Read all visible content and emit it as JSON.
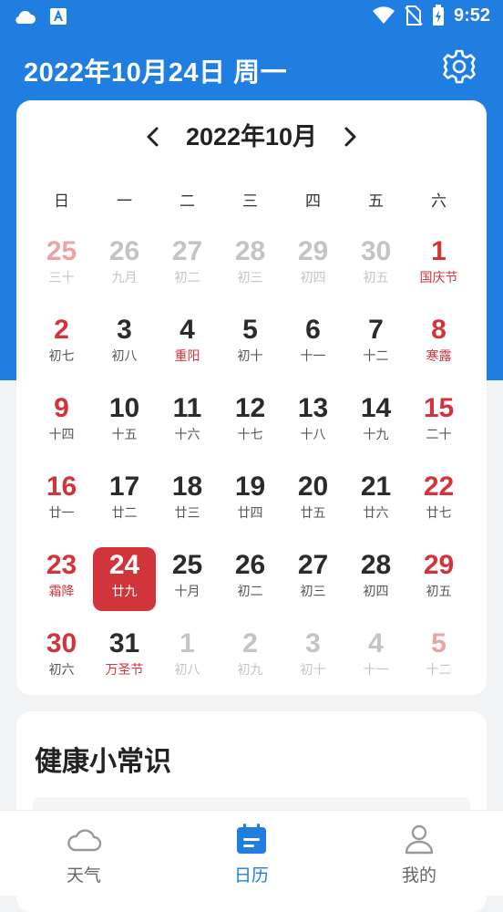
{
  "status_bar": {
    "time": "9:52"
  },
  "header": {
    "title": "2022年10月24日 周一"
  },
  "calendar": {
    "month_title": "2022年10月",
    "weekdays": [
      "日",
      "一",
      "二",
      "三",
      "四",
      "五",
      "六"
    ],
    "days": [
      {
        "num": "25",
        "sub": "三十",
        "type": "otherwk"
      },
      {
        "num": "26",
        "sub": "九月",
        "type": "other"
      },
      {
        "num": "27",
        "sub": "初二",
        "type": "other"
      },
      {
        "num": "28",
        "sub": "初三",
        "type": "other"
      },
      {
        "num": "29",
        "sub": "初四",
        "type": "other"
      },
      {
        "num": "30",
        "sub": "初五",
        "type": "other"
      },
      {
        "num": "1",
        "sub": "国庆节",
        "type": "wk fest"
      },
      {
        "num": "2",
        "sub": "初七",
        "type": "wk"
      },
      {
        "num": "3",
        "sub": "初八",
        "type": "dark"
      },
      {
        "num": "4",
        "sub": "重阳",
        "type": "dark fest"
      },
      {
        "num": "5",
        "sub": "初十",
        "type": "dark"
      },
      {
        "num": "6",
        "sub": "十一",
        "type": "dark"
      },
      {
        "num": "7",
        "sub": "十二",
        "type": "dark"
      },
      {
        "num": "8",
        "sub": "寒露",
        "type": "wk fest"
      },
      {
        "num": "9",
        "sub": "十四",
        "type": "wk"
      },
      {
        "num": "10",
        "sub": "十五",
        "type": "dark"
      },
      {
        "num": "11",
        "sub": "十六",
        "type": "dark"
      },
      {
        "num": "12",
        "sub": "十七",
        "type": "dark"
      },
      {
        "num": "13",
        "sub": "十八",
        "type": "dark"
      },
      {
        "num": "14",
        "sub": "十九",
        "type": "dark"
      },
      {
        "num": "15",
        "sub": "二十",
        "type": "wk"
      },
      {
        "num": "16",
        "sub": "廿一",
        "type": "wk"
      },
      {
        "num": "17",
        "sub": "廿二",
        "type": "dark"
      },
      {
        "num": "18",
        "sub": "廿三",
        "type": "dark"
      },
      {
        "num": "19",
        "sub": "廿四",
        "type": "dark"
      },
      {
        "num": "20",
        "sub": "廿五",
        "type": "dark"
      },
      {
        "num": "21",
        "sub": "廿六",
        "type": "dark"
      },
      {
        "num": "22",
        "sub": "廿七",
        "type": "wk"
      },
      {
        "num": "23",
        "sub": "霜降",
        "type": "wk fest"
      },
      {
        "num": "24",
        "sub": "廿九",
        "type": "dark selected"
      },
      {
        "num": "25",
        "sub": "十月",
        "type": "dark"
      },
      {
        "num": "26",
        "sub": "初二",
        "type": "dark"
      },
      {
        "num": "27",
        "sub": "初三",
        "type": "dark"
      },
      {
        "num": "28",
        "sub": "初四",
        "type": "dark"
      },
      {
        "num": "29",
        "sub": "初五",
        "type": "wk"
      },
      {
        "num": "30",
        "sub": "初六",
        "type": "wk"
      },
      {
        "num": "31",
        "sub": "万圣节",
        "type": "dark fest"
      },
      {
        "num": "1",
        "sub": "初八",
        "type": "other"
      },
      {
        "num": "2",
        "sub": "初九",
        "type": "other"
      },
      {
        "num": "3",
        "sub": "初十",
        "type": "other"
      },
      {
        "num": "4",
        "sub": "十一",
        "type": "other"
      },
      {
        "num": "5",
        "sub": "十二",
        "type": "otherwk"
      }
    ]
  },
  "health": {
    "title": "健康小常识"
  },
  "bottom_nav": {
    "tabs": [
      {
        "label": "天气",
        "icon": "cloud-icon"
      },
      {
        "label": "日历",
        "icon": "calendar-icon"
      },
      {
        "label": "我的",
        "icon": "user-icon"
      }
    ]
  },
  "colors": {
    "primary": "#1f7ee0",
    "accent_red": "#d2343c"
  }
}
